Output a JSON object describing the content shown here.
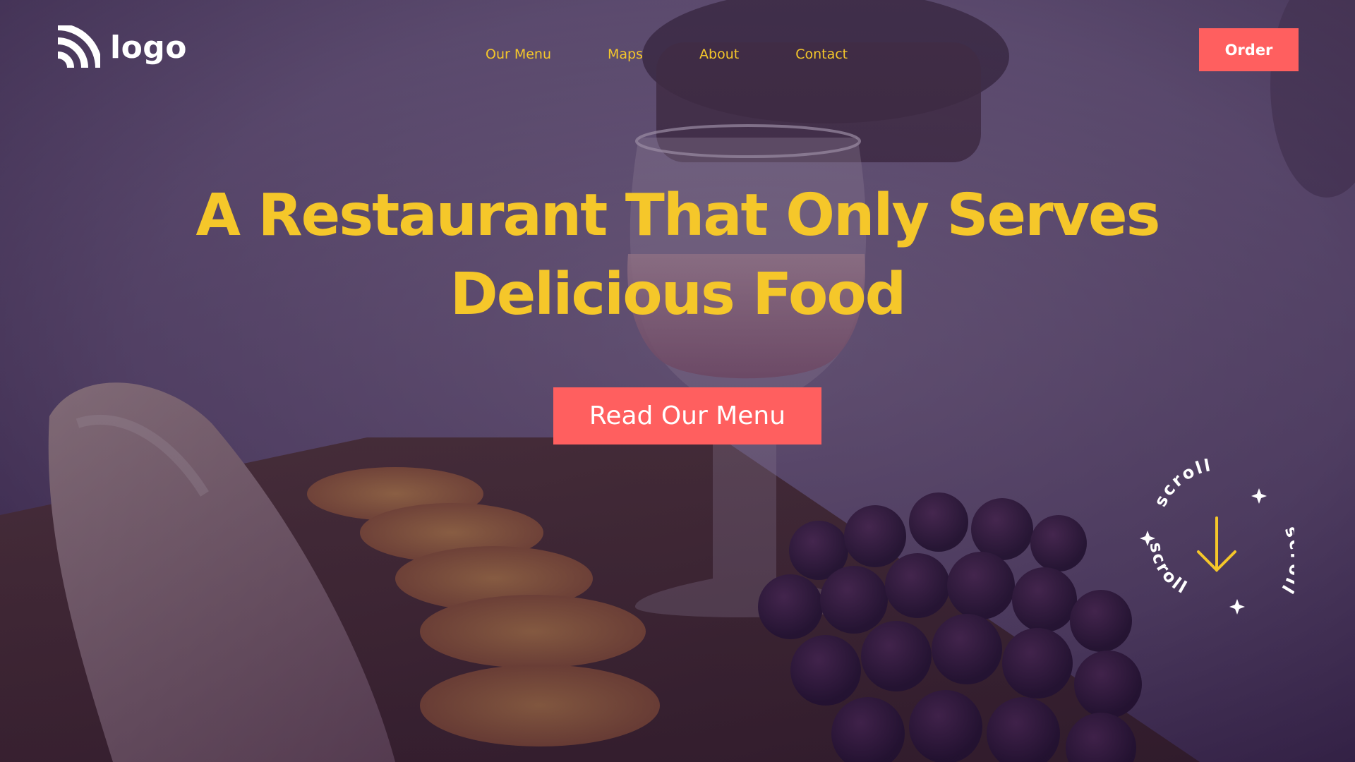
{
  "header": {
    "logo_text": "logo",
    "logo_icon": "signal-arcs-icon",
    "nav": [
      "Our Menu",
      "Maps",
      "About",
      "Contact"
    ],
    "order_label": "Order"
  },
  "hero": {
    "title_line1": "A Restaurant That Only Serves",
    "title_line2": "Delicious Food",
    "cta_label": "Read Our Menu"
  },
  "scroll_indicator": {
    "text": "scroll",
    "icon": "arrow-down-icon",
    "decor_icon": "sparkle-icon"
  },
  "colors": {
    "accent_yellow": "#f5c72a",
    "button_coral": "#ff5f5f",
    "overlay_purple": "#3a2850"
  }
}
